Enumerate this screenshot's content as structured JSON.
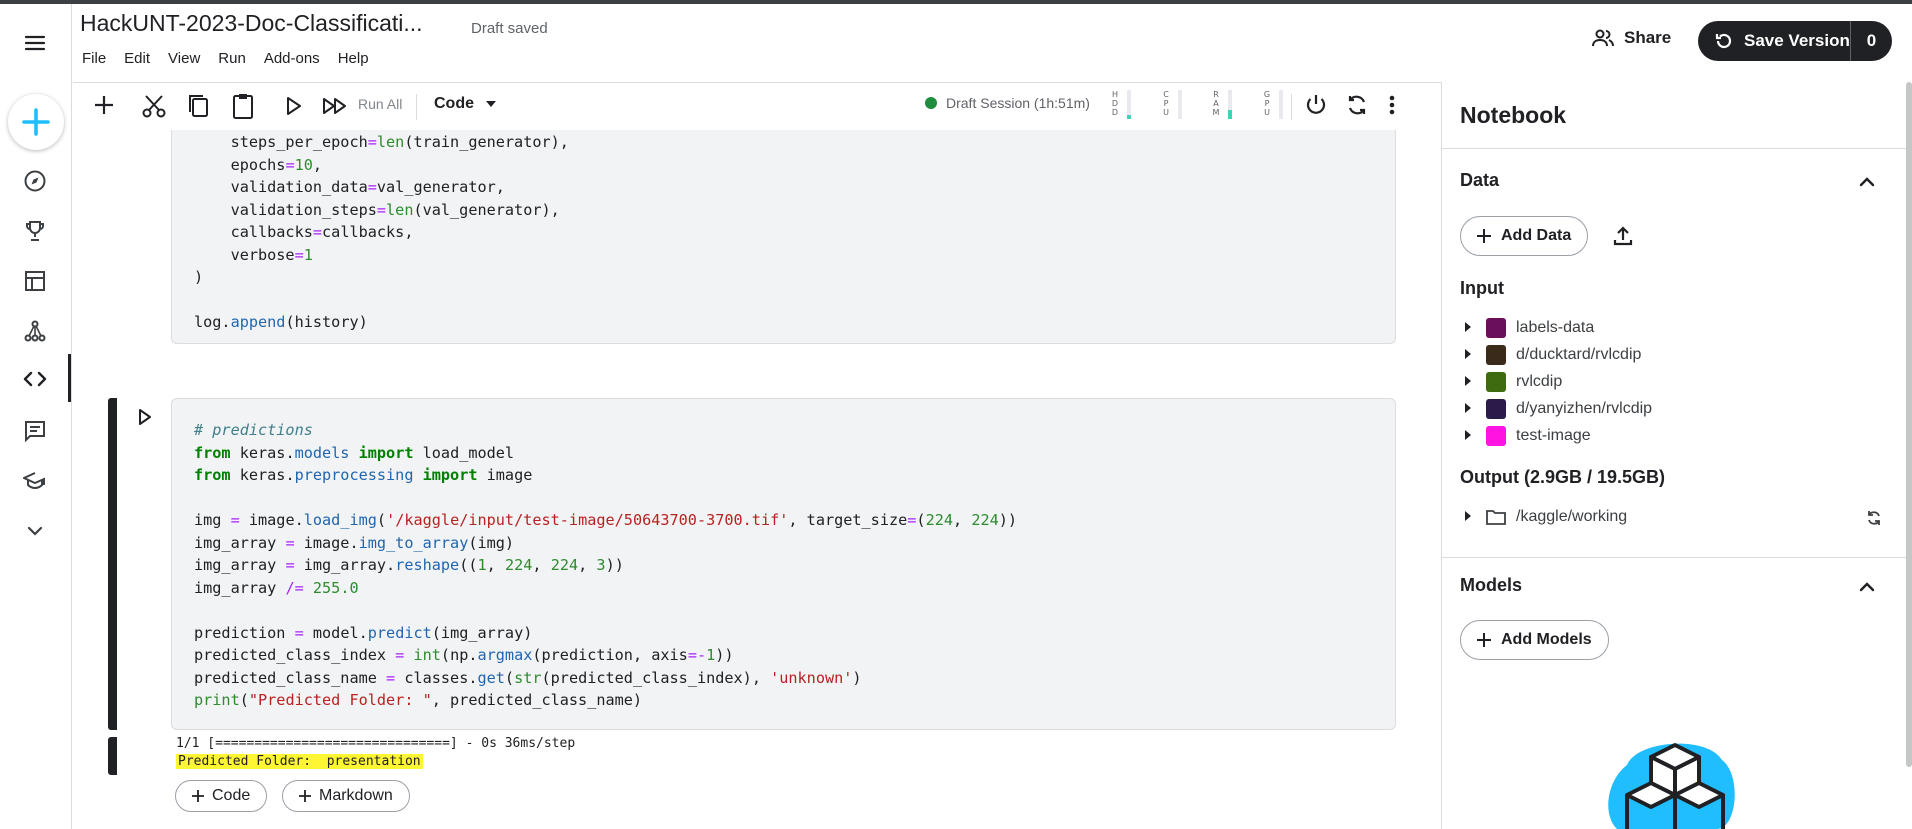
{
  "notebook": {
    "title": "HackUNT-2023-Doc-Classificati...",
    "status": "Draft saved"
  },
  "menu": [
    "File",
    "Edit",
    "View",
    "Run",
    "Add-ons",
    "Help"
  ],
  "header": {
    "share_label": "Share",
    "save_version_label": "Save Version",
    "save_version_count": "0"
  },
  "toolbar": {
    "run_all_label": "Run All",
    "cell_type": "Code",
    "session_label": "Draft Session (1h:51m)",
    "meters": [
      {
        "label": "HDD",
        "level": 0.15
      },
      {
        "label": "CPU",
        "level": 0.0
      },
      {
        "label": "RAM",
        "level": 0.3
      },
      {
        "label": "GPU",
        "level": 0.0
      }
    ]
  },
  "cell1": {
    "lines": [
      "    steps_per_epoch=len(train_generator),",
      "    epochs=10,",
      "    validation_data=val_generator,",
      "    validation_steps=len(val_generator),",
      "    callbacks=callbacks,",
      "    verbose=1",
      ")",
      "",
      "log.append(history)"
    ]
  },
  "cell2": {
    "comment": "# predictions",
    "lines": [
      "from keras.models import load_model",
      "from keras.preprocessing import image",
      "",
      "img = image.load_img('/kaggle/input/test-image/50643700-3700.tif', target_size=(224, 224))",
      "img_array = image.img_to_array(img)",
      "img_array = img_array.reshape((1, 224, 224, 3))",
      "img_array /= 255.0",
      "",
      "prediction = model.predict(img_array)",
      "predicted_class_index = int(np.argmax(prediction, axis=-1))",
      "predicted_class_name = classes.get(str(predicted_class_index), 'unknown')",
      "print(\"Predicted Folder: \", predicted_class_name)"
    ]
  },
  "output": {
    "progress_line": "1/1 [==============================] - 0s 36ms/step",
    "result_line": "Predicted Folder:  presentation"
  },
  "add_cell": {
    "code_label": "Code",
    "markdown_label": "Markdown"
  },
  "panel": {
    "title": "Notebook",
    "data_heading": "Data",
    "add_data_label": "Add Data",
    "input_heading": "Input",
    "inputs": [
      {
        "name": "labels-data",
        "color": "#6a0f5a"
      },
      {
        "name": "d/ducktard/rvlcdip",
        "color": "#3a2a1a"
      },
      {
        "name": "rvlcdip",
        "color": "#3f6b10"
      },
      {
        "name": "d/yanyizhen/rvlcdip",
        "color": "#2b1b4a"
      },
      {
        "name": "test-image",
        "color": "#ff13e0"
      }
    ],
    "output_heading": "Output (2.9GB / 19.5GB)",
    "working_dir": "/kaggle/working",
    "models_heading": "Models",
    "add_models_label": "Add Models"
  },
  "colors": {
    "accent": "#20beff",
    "session_green": "#1e8e3e",
    "highlight": "#fff633",
    "dark": "#202124"
  }
}
